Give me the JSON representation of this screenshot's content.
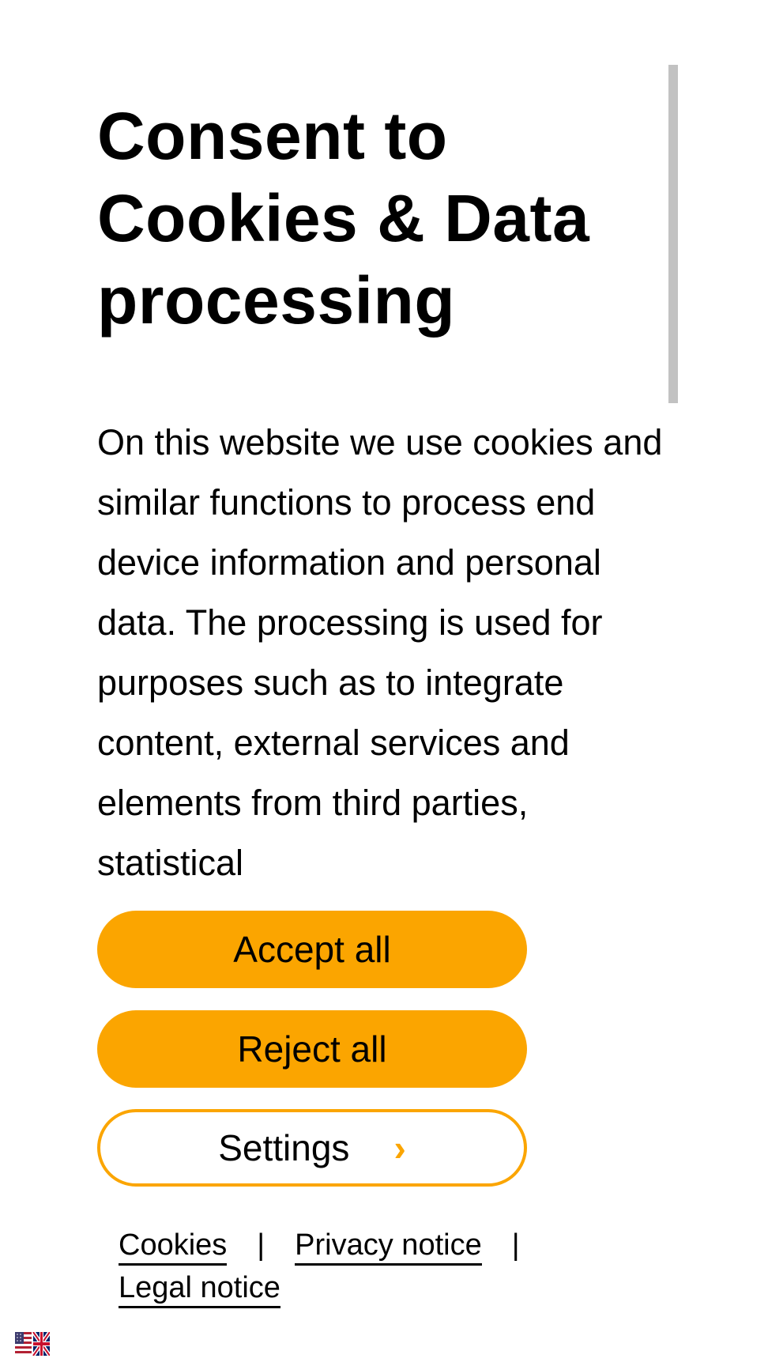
{
  "dialog": {
    "title": "Consent to Cookies & Data processing",
    "body": "On this website we use cookies and similar functions to process end device information and personal data. The processing is used for purposes such as to integrate content, external services and elements from third parties, statistical"
  },
  "buttons": {
    "accept_label": "Accept all",
    "reject_label": "Reject all",
    "settings_label": "Settings",
    "settings_chevron": "›"
  },
  "footer": {
    "cookies_label": "Cookies",
    "separator": "|",
    "privacy_label": "Privacy notice",
    "legal_label": "Legal notice"
  },
  "language": {
    "icon": "us-uk-flag-icon"
  },
  "colors": {
    "accent": "#fba500",
    "scrollbar": "#c2c2c2",
    "text": "#000000",
    "background": "#ffffff"
  }
}
